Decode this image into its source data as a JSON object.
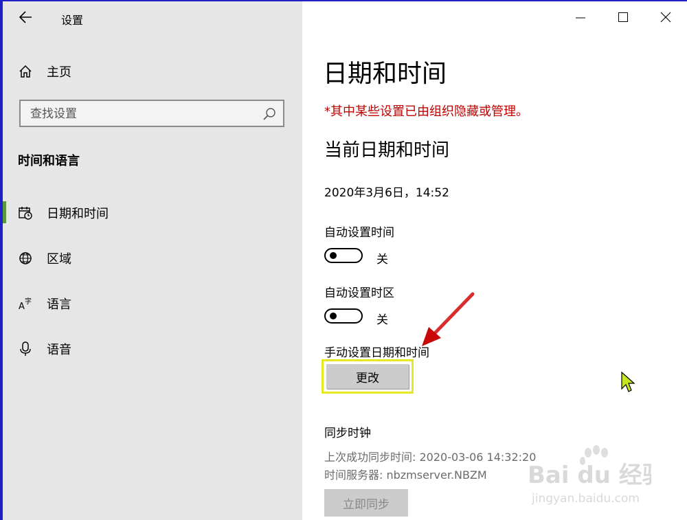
{
  "window": {
    "title": "设置"
  },
  "sidebar": {
    "home_label": "主页",
    "search_placeholder": "查找设置",
    "section_title": "时间和语言",
    "items": [
      {
        "label": "日期和时间",
        "icon": "calendar-clock-icon",
        "active": true
      },
      {
        "label": "区域",
        "icon": "globe-icon",
        "active": false
      },
      {
        "label": "语言",
        "icon": "language-icon",
        "active": false
      },
      {
        "label": "语音",
        "icon": "microphone-icon",
        "active": false
      }
    ],
    "active_color": "#5b9a3b"
  },
  "main": {
    "page_title": "日期和时间",
    "policy_warning": "*其中某些设置已由组织隐藏或管理。",
    "current_heading": "当前日期和时间",
    "current_datetime": "2020年3月6日，14:52",
    "auto_time": {
      "label": "自动设置时间",
      "state": "关"
    },
    "auto_timezone": {
      "label": "自动设置时区",
      "state": "关"
    },
    "manual": {
      "label": "手动设置日期和时间",
      "button": "更改"
    },
    "sync": {
      "heading": "同步时钟",
      "last_sync": "上次成功同步时间: 2020-03-06 14:32:20",
      "server": "时间服务器: nbzmserver.NBZM",
      "button": "立即同步"
    }
  },
  "watermark": {
    "brand": "Bai du 经验",
    "url": "jingyan.baidu.com"
  },
  "colors": {
    "warning": "#c00000",
    "highlight_border": "#e8e820",
    "annotation_arrow": "#d01010"
  }
}
